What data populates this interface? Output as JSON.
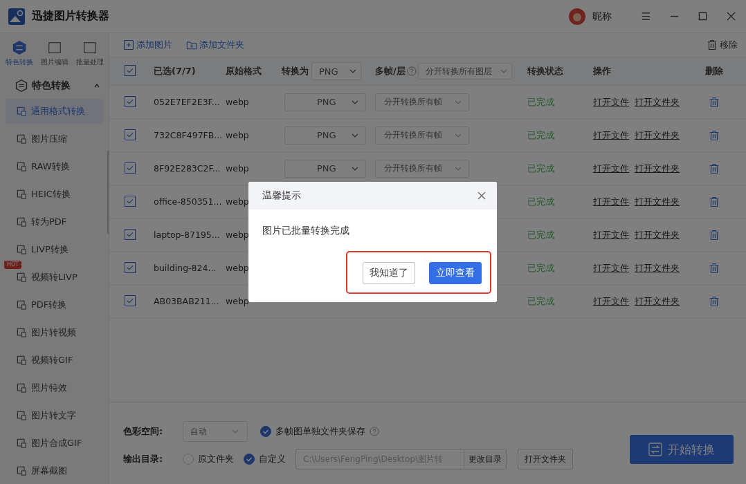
{
  "app": {
    "title": "迅捷图片转换器",
    "user": "昵称"
  },
  "mode_tabs": [
    {
      "label": "特色转换",
      "selected": true
    },
    {
      "label": "图片编辑",
      "selected": false
    },
    {
      "label": "批量处理",
      "selected": false
    }
  ],
  "sidebar": {
    "section": {
      "label": "特色转换",
      "expanded": true
    },
    "items": [
      {
        "label": "通用格式转换",
        "selected": true
      },
      {
        "label": "图片压缩",
        "selected": false
      },
      {
        "label": "RAW转换",
        "selected": false
      },
      {
        "label": "HEIC转换",
        "selected": false
      },
      {
        "label": "转为PDF",
        "selected": false
      },
      {
        "label": "LIVP转换",
        "selected": false
      },
      {
        "label": "视频转LIVP",
        "selected": false,
        "badge": "HOT"
      },
      {
        "label": "PDF转换",
        "selected": false
      },
      {
        "label": "图片转视频",
        "selected": false
      },
      {
        "label": "视频转GIF",
        "selected": false
      },
      {
        "label": "照片特效",
        "selected": false
      },
      {
        "label": "图片转文字",
        "selected": false
      },
      {
        "label": "图片合成GIF",
        "selected": false
      },
      {
        "label": "屏幕截图",
        "selected": false
      }
    ]
  },
  "toolbar": {
    "add_image": "添加图片",
    "add_folder": "添加文件夹",
    "remove": "移除"
  },
  "table": {
    "header": {
      "checked": true,
      "selected_count": "已选(7/7)",
      "original_format": "原始格式",
      "convert_to": "转换为",
      "convert_to_value": "PNG",
      "frames": "多帧/层",
      "frames_value": "分开转换所有图层",
      "status": "转换状态",
      "actions": "操作",
      "delete": "删除"
    },
    "rows": [
      {
        "checked": true,
        "name": "052E7EF2E3F...",
        "format": "webp",
        "convert_to": "PNG",
        "frames": "分开转换所有帧",
        "status": "已完成",
        "open_file": "打开文件",
        "open_folder": "打开文件夹"
      },
      {
        "checked": true,
        "name": "732C8F497FB...",
        "format": "webp",
        "convert_to": "PNG",
        "frames": "分开转换所有帧",
        "status": "已完成",
        "open_file": "打开文件",
        "open_folder": "打开文件夹"
      },
      {
        "checked": true,
        "name": "8F92E283C2F...",
        "format": "webp",
        "convert_to": "PNG",
        "frames": "分开转换所有帧",
        "status": "已完成",
        "open_file": "打开文件",
        "open_folder": "打开文件夹"
      },
      {
        "checked": true,
        "name": "office-850351...",
        "format": "webp",
        "status": "已完成",
        "open_file": "打开文件",
        "open_folder": "打开文件夹"
      },
      {
        "checked": true,
        "name": "laptop-87195...",
        "format": "webp",
        "status": "已完成",
        "open_file": "打开文件",
        "open_folder": "打开文件夹"
      },
      {
        "checked": true,
        "name": "building-824...",
        "format": "webp",
        "status": "已完成",
        "open_file": "打开文件",
        "open_folder": "打开文件夹"
      },
      {
        "checked": true,
        "name": "AB03BAB211...",
        "format": "webp",
        "status": "已完成",
        "open_file": "打开文件",
        "open_folder": "打开文件夹"
      }
    ]
  },
  "bottom": {
    "color_space_label": "色彩空间:",
    "color_space": "自动",
    "multi_frame_folder": {
      "label": "多帧图单独文件夹保存",
      "checked": true
    },
    "output_label": "输出目录:",
    "output_options": [
      {
        "label": "原文件夹",
        "selected": false
      },
      {
        "label": "自定义",
        "selected": true
      }
    ],
    "output_path": "C:\\Users\\FengPing\\Desktop\\图片转",
    "change_dir": "更改目录",
    "open_folder": "打开文件夹",
    "start": "开始转换"
  },
  "dialog": {
    "title": "温馨提示",
    "message": "图片已批量转换完成",
    "highlighted": true,
    "buttons": [
      {
        "label": "我知道了",
        "kind": "secondary"
      },
      {
        "label": "立即查看",
        "kind": "primary"
      }
    ]
  }
}
